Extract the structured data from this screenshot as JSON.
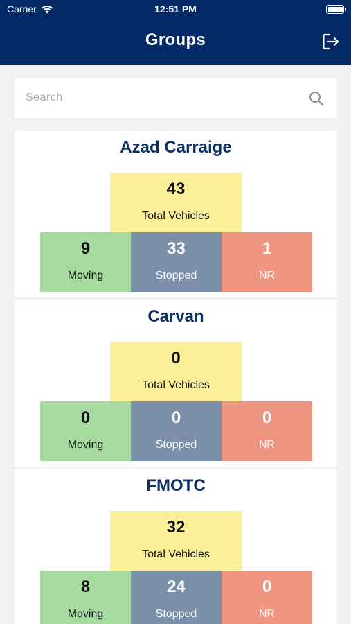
{
  "status_bar": {
    "carrier": "Carrier",
    "time": "12:51 PM"
  },
  "header": {
    "title": "Groups"
  },
  "search": {
    "placeholder": "Search",
    "value": ""
  },
  "groups": [
    {
      "name": "Azad Carraige",
      "total": "43",
      "total_label": "Total Vehicles",
      "moving": "9",
      "moving_label": "Moving",
      "stopped": "33",
      "stopped_label": "Stopped",
      "nr": "1",
      "nr_label": "NR"
    },
    {
      "name": "Carvan",
      "total": "0",
      "total_label": "Total Vehicles",
      "moving": "0",
      "moving_label": "Moving",
      "stopped": "0",
      "stopped_label": "Stopped",
      "nr": "0",
      "nr_label": "NR"
    },
    {
      "name": "FMOTC",
      "total": "32",
      "total_label": "Total Vehicles",
      "moving": "8",
      "moving_label": "Moving",
      "stopped": "24",
      "stopped_label": "Stopped",
      "nr": "0",
      "nr_label": "NR"
    }
  ],
  "colors": {
    "header_bg": "#032a66",
    "group_title": "#0c2f66",
    "total_bg": "#fbf09a",
    "moving_bg": "#a6dba0",
    "stopped_bg": "#7b8faa",
    "nr_bg": "#ef9683"
  },
  "icons": {
    "wifi": "wifi-icon",
    "battery": "battery-icon",
    "logout": "logout-icon",
    "search": "search-icon"
  }
}
